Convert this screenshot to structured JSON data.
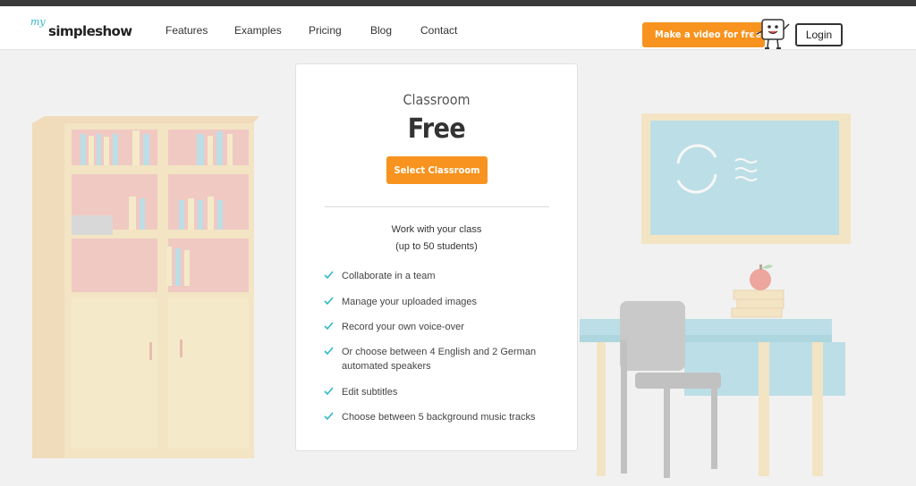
{
  "header": {
    "logo_prefix": "my",
    "logo_name": "simpleshow",
    "nav": [
      "Features",
      "Examples",
      "Pricing",
      "Blog",
      "Contact"
    ],
    "cta_label": "Make a video for free",
    "login_label": "Login"
  },
  "plan": {
    "name": "Classroom",
    "price": "Free",
    "button_label": "Select Classroom",
    "intro_line1": "Work with your class",
    "intro_line2": "(up to 50 students)",
    "features": [
      "Collaborate in a team",
      "Manage your uploaded images",
      "Record your own voice-over",
      "Or choose between 4 English and 2 German automated speakers",
      "Edit subtitles",
      "Choose between 5 background music tracks"
    ]
  },
  "colors": {
    "accent": "#f7931e",
    "check": "#2eb8c9",
    "text": "#333333"
  }
}
